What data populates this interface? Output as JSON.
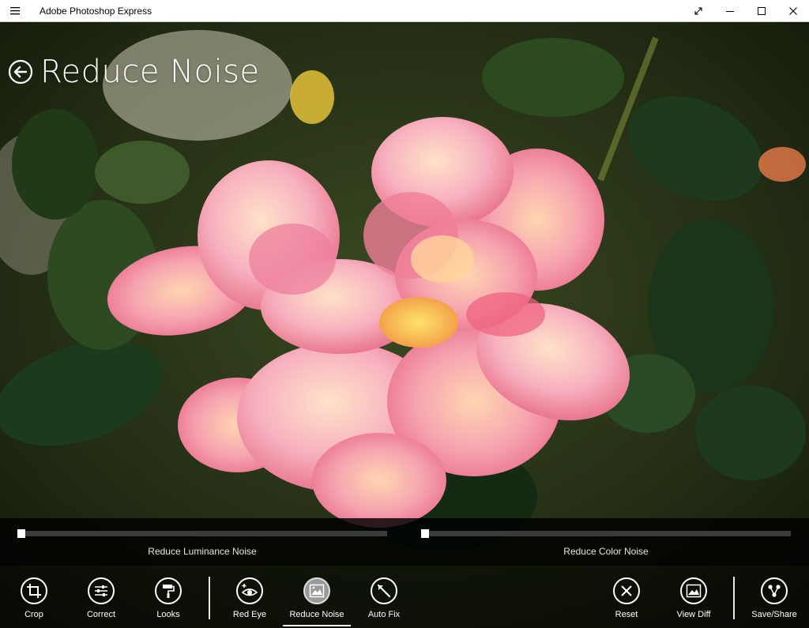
{
  "window": {
    "title": "Adobe Photoshop Express"
  },
  "header": {
    "title": "Reduce Noise"
  },
  "sliders": [
    {
      "label": "Reduce Luminance Noise",
      "value": 0
    },
    {
      "label": "Reduce Color Noise",
      "value": 0
    }
  ],
  "toolbar": {
    "crop": "Crop",
    "correct": "Correct",
    "looks": "Looks",
    "red_eye": "Red Eye",
    "reduce_noise": "Reduce Noise",
    "auto_fix": "Auto Fix",
    "reset": "Reset",
    "view_diff": "View Diff",
    "save_share": "Save/Share"
  },
  "colors": {
    "accent": "#ffffff",
    "titlebar_bg": "#ffffff",
    "active_tool_bg": "#9a9a9a"
  }
}
